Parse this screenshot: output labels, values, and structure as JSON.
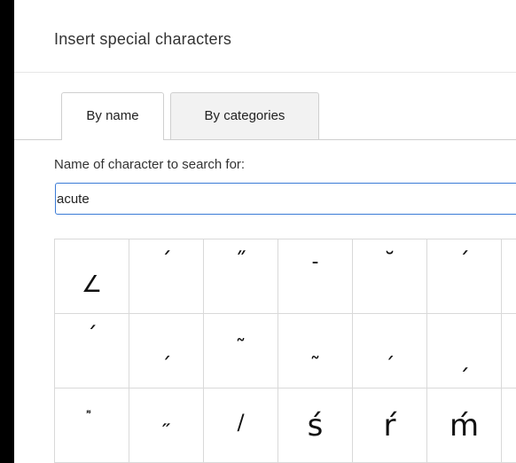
{
  "dialog": {
    "title": "Insert special characters"
  },
  "tabs": [
    {
      "label": "By name",
      "active": true
    },
    {
      "label": "By categories",
      "active": false
    }
  ],
  "search": {
    "label": "Name of character to search for:",
    "value": "acute"
  },
  "characters": [
    "∠",
    "ˊ",
    "˝",
    "˗",
    "˘",
    "ˊ",
    "",
    "ˊ",
    "ˏ",
    "˜",
    "˷",
    "ˏ",
    "ˏ",
    "",
    "͌",
    "˶",
    "/",
    "ś",
    "ŕ",
    "ḿ",
    ""
  ]
}
